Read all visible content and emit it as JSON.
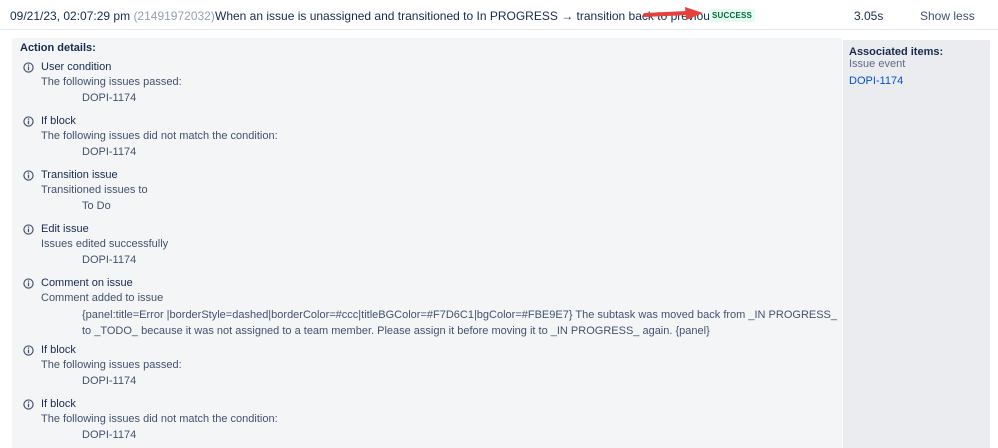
{
  "header": {
    "date": "09/21/23, 02:07:29 pm",
    "audit_id": "(21491972032)",
    "rule_description": "When an issue is unassigned and transitioned to In PROGRESS → transition back to previous status",
    "status": "SUCCESS",
    "duration": "3.05s",
    "show_less": "Show less",
    "colors": {
      "status_bg": "#e3fcef",
      "status_text": "#006644",
      "arrow": "#e5403a"
    }
  },
  "details": {
    "title": "Action details:",
    "icon": "info-icon",
    "actions": [
      {
        "name": "User condition",
        "desc": "The following issues passed:",
        "value": "DOPI-1174"
      },
      {
        "name": "If block",
        "desc": "The following issues did not match the condition:",
        "value": "DOPI-1174"
      },
      {
        "name": "Transition issue",
        "desc": "Transitioned issues to",
        "value": "To Do"
      },
      {
        "name": "Edit issue",
        "desc": "Issues edited successfully",
        "value": "DOPI-1174"
      },
      {
        "name": "Comment on issue",
        "desc": "Comment added to issue",
        "value": "{panel:title=Error |borderStyle=dashed|borderColor=#ccc|titleBGColor=#F7D6C1|bgColor=#FBE9E7} The subtask was moved back from _IN PROGRESS_ to _TODO_ because it was not assigned to a team member. Please assign it before moving it to _IN PROGRESS_ again. {panel}"
      },
      {
        "name": "If block",
        "desc": "The following issues passed:",
        "value": "DOPI-1174"
      },
      {
        "name": "If block",
        "desc": "The following issues did not match the condition:",
        "value": "DOPI-1174"
      }
    ]
  },
  "associated": {
    "title": "Associated items:",
    "subtitle": "Issue event",
    "link": "DOPI-1174"
  }
}
